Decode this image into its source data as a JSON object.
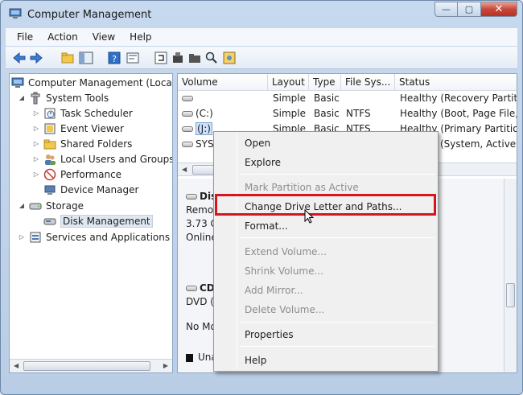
{
  "window": {
    "title": "Computer Management",
    "controls": {
      "minimize": "—",
      "maximize": "▢",
      "close": "✕"
    }
  },
  "menubar": {
    "items": [
      "File",
      "Action",
      "View",
      "Help"
    ]
  },
  "tree": {
    "root": "Computer Management (Local",
    "items": [
      {
        "label": "System Tools",
        "level": 1,
        "expander": "◢"
      },
      {
        "label": "Task Scheduler",
        "level": 2,
        "expander": "▷"
      },
      {
        "label": "Event Viewer",
        "level": 2,
        "expander": "▷"
      },
      {
        "label": "Shared Folders",
        "level": 2,
        "expander": "▷"
      },
      {
        "label": "Local Users and Groups",
        "level": 2,
        "expander": "▷"
      },
      {
        "label": "Performance",
        "level": 2,
        "expander": "▷"
      },
      {
        "label": "Device Manager",
        "level": 2,
        "expander": ""
      },
      {
        "label": "Storage",
        "level": 1,
        "expander": "◢"
      },
      {
        "label": "Disk Management",
        "level": 2,
        "expander": ""
      },
      {
        "label": "Services and Applications",
        "level": 1,
        "expander": "▷"
      }
    ],
    "scroll_left": "◀",
    "scroll_right": "▶"
  },
  "volumes": {
    "columns": [
      "Volume",
      "Layout",
      "Type",
      "File Sys...",
      "Status"
    ],
    "rows": [
      {
        "volume": "",
        "layout": "Simple",
        "type": "Basic",
        "fs": "",
        "status": "Healthy (Recovery Partitic"
      },
      {
        "volume": "(C:)",
        "layout": "Simple",
        "type": "Basic",
        "fs": "NTFS",
        "status": "Healthy (Boot, Page File, \\"
      },
      {
        "volume": "(J:)",
        "layout": "Simple",
        "type": "Basic",
        "fs": "NTFS",
        "status": "Healthy (Primary Partitior"
      },
      {
        "volume": "SYST",
        "layout": "",
        "type": "",
        "fs": "",
        "status": "(System, Active, P"
      }
    ],
    "scroll_left": "◀"
  },
  "disks": {
    "disk1": {
      "name": "Dis",
      "line1": "Remo",
      "line2": "3.73 G",
      "line3": "Online"
    },
    "cd": {
      "name": "CD",
      "line1": "DVD (I",
      "line2": "No Mo"
    },
    "legend": "Una"
  },
  "context_menu": {
    "items": [
      {
        "label": "Open",
        "enabled": true
      },
      {
        "label": "Explore",
        "enabled": true
      },
      {
        "label": "Mark Partition as Active",
        "enabled": false
      },
      {
        "label": "Change Drive Letter and Paths...",
        "enabled": true
      },
      {
        "label": "Format...",
        "enabled": true
      },
      {
        "label": "Extend Volume...",
        "enabled": false
      },
      {
        "label": "Shrink Volume...",
        "enabled": false
      },
      {
        "label": "Add Mirror...",
        "enabled": false
      },
      {
        "label": "Delete Volume...",
        "enabled": false
      },
      {
        "label": "Properties",
        "enabled": true
      },
      {
        "label": "Help",
        "enabled": true
      }
    ]
  },
  "colors": {
    "highlight_box": "#d6151e",
    "selection": "#cfe2fb",
    "frame": "#b9cde6"
  }
}
